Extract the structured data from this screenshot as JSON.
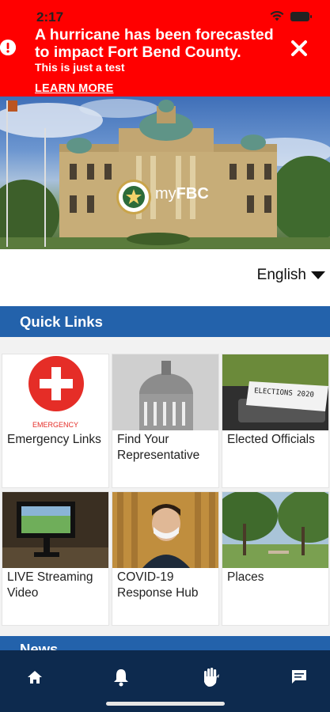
{
  "status_bar": {
    "time": "2:17"
  },
  "alert": {
    "title": "A hurricane has been forecasted to impact Fort Bend County.",
    "subtitle": "This is just a test",
    "link": "LEARN MORE"
  },
  "hero": {
    "logo_prefix": "my",
    "logo_bold": "FBC"
  },
  "language": {
    "selected": "English"
  },
  "quick_links": {
    "title": "Quick Links",
    "emergency_caption": "EMERGENCY",
    "items": [
      {
        "label": "Emergency Links"
      },
      {
        "label": "Find Your Representative"
      },
      {
        "label": "Elected Officials"
      },
      {
        "label": "LIVE Streaming Video"
      },
      {
        "label": "COVID-19 Response Hub"
      },
      {
        "label": "Places"
      }
    ],
    "election_sign": "ELECTIONS 2020"
  },
  "news": {
    "title": "News"
  },
  "nav": {
    "items": [
      {
        "icon": "home-icon"
      },
      {
        "icon": "bell-icon"
      },
      {
        "icon": "hand-icon"
      },
      {
        "icon": "chat-icon"
      }
    ]
  },
  "colors": {
    "alert": "#ff0000",
    "header": "#2362ab",
    "nav": "#0d2a4e"
  }
}
